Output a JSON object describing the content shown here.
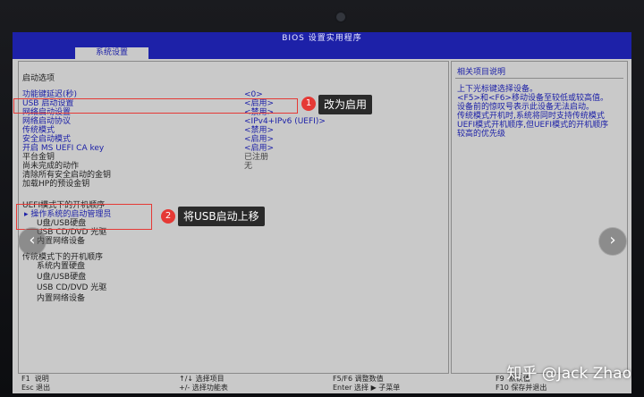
{
  "window": {
    "title": "BIOS 设置实用程序",
    "active_tab": "系统设置"
  },
  "main": {
    "section_title": "启动选项",
    "rows": [
      {
        "label": "功能键延迟(秒)",
        "value": "<0>"
      },
      {
        "label": "USB 启动设置",
        "value": "<启用>"
      },
      {
        "label": "网络启动设置",
        "value": "<禁用>"
      },
      {
        "label": "网络启动协议",
        "value": "<IPv4+IPv6 (UEFI)>"
      },
      {
        "label": "传统模式",
        "value": "<禁用>"
      },
      {
        "label": "安全启动模式",
        "value": "<启用>"
      },
      {
        "label": "开启 MS UEFI CA key",
        "value": "<启用>"
      },
      {
        "label": "平台金钥",
        "value": "已注册"
      },
      {
        "label": "尚未完成的动作",
        "value": "无"
      },
      {
        "label": "清除所有安全启动的金钥",
        "value": ""
      },
      {
        "label": "加载HP的预设金钥",
        "value": ""
      }
    ],
    "uefi_order_title": "UEFI模式下的开机顺序",
    "uefi_order": [
      "操作系统的启动管理员",
      "U盘/USB硬盘",
      "USB CD/DVD 光驱",
      "内置网络设备"
    ],
    "legacy_order_title": "传统模式下的开机顺序",
    "legacy_order": [
      "系统内置硬盘",
      "U盘/USB硬盘",
      "USB CD/DVD 光驱",
      "内置网络设备"
    ]
  },
  "help": {
    "title": "相关项目说明",
    "lines": [
      "上下光标键选择设备。",
      "<F5>和<F6>移动设备至较低或较高值。",
      "设备前的惊叹号表示此设备无法启动。",
      "传统模式开机时,系统将同时支持传统模式",
      "UEFI模式开机顺序,但UEFI模式的开机顺序",
      "较高的优先级"
    ]
  },
  "footer": {
    "keys": [
      {
        "key": "F1",
        "desc": "说明"
      },
      {
        "key": "Esc",
        "desc": "退出"
      },
      {
        "key": "↑/↓",
        "desc": "选择项目"
      },
      {
        "key": "+/-",
        "desc": "选择功能表"
      },
      {
        "key": "F5/F6",
        "desc": "调整数值"
      },
      {
        "key": "Enter",
        "desc": "选择 ▶ 子菜单"
      },
      {
        "key": "F9",
        "desc": "默认值"
      },
      {
        "key": "F10",
        "desc": "保存并退出"
      }
    ]
  },
  "annotations": {
    "badge1": "1",
    "callout1": "改为启用",
    "badge2": "2",
    "callout2": "将USB启动上移"
  },
  "nav": {
    "prev_glyph": "‹",
    "next_glyph": "›"
  },
  "watermark": "知乎 @Jack Zhao",
  "colors": {
    "bios_blue": "#1d21a8",
    "bios_gray": "#c9c9c9",
    "annotation_red": "#e53935"
  }
}
